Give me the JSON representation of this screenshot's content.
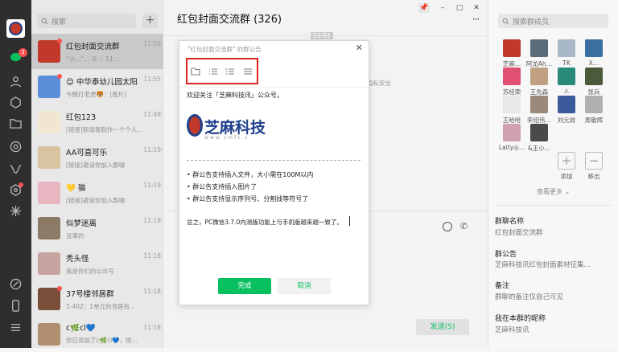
{
  "sidebar": {
    "badge_chat": "2"
  },
  "chatlist": {
    "search_placeholder": "搜索",
    "add_label": "+",
    "items": [
      {
        "name": "红包封面交流群",
        "time": "11:56",
        "msg": "\"小…\"…  ® ：11:…",
        "color": "#c0392b"
      },
      {
        "name": "😊 中华泰幼儿园太阳…",
        "time": "11:55",
        "msg": "今晚打老虎🐯：[图片]",
        "color": "#5a8fd8"
      },
      {
        "name": "红包123",
        "time": "11:48",
        "msg": "[链接]新增我制作一个个人…",
        "color": "#f0e6d2"
      },
      {
        "name": "AA可喜可乐",
        "time": "11:19",
        "msg": "[链接]邀请你加入群聊",
        "color": "#d8c4a0"
      },
      {
        "name": "💛 猫",
        "time": "11:19",
        "msg": "[链接]邀请你加入群聊",
        "color": "#e8b5c0"
      },
      {
        "name": "似梦迷离",
        "time": "11:18",
        "msg": "没事的",
        "color": "#8a7a66"
      },
      {
        "name": "秃头怪",
        "time": "11:18",
        "msg": "我是你们的公众号",
        "color": "#c7a4a0"
      },
      {
        "name": "37号楼邻居群",
        "time": "11:18",
        "msg": "1-402：1单元的邻居有…",
        "color": "#7a4f3a"
      },
      {
        "name": "c🌿cl💙",
        "time": "11:18",
        "msg": "你已添加了c🌿cl💙，现…",
        "color": "#b09070"
      }
    ]
  },
  "main": {
    "title": "红包封面交流群 (326)",
    "time_badge": "11:51",
    "privacy_hint": "隐私安全",
    "send_label": "发送(S)"
  },
  "dialog": {
    "title": "\"红包封面交流群\" 的群公告",
    "close": "✕",
    "line1": "欢迎关注「芝麻科技讯」公众号。",
    "logo_cn": "芝麻科技",
    "logo_url": "www.zmfc.c",
    "bullet1": "• 群公告支持插入文件，大小需在100M以内",
    "bullet2": "• 群公告支持插入图片了",
    "bullet3": "• 群公告支持显示序列号、分割线等符号了",
    "summary": "总之，PC微信3.7.0内测版功能上与手机版越来越一致了。",
    "ok_label": "完成",
    "cancel_label": "取消"
  },
  "right": {
    "search_placeholder": "搜索群成员",
    "members": [
      {
        "name": "芝麻…",
        "color": "#c0392b"
      },
      {
        "name": "阿龙Ah…",
        "color": "#5b6b7a"
      },
      {
        "name": "TK",
        "color": "#a8b8c8"
      },
      {
        "name": "X…",
        "color": "#3a6fa0"
      },
      {
        "name": "苏桂荣",
        "color": "#e05070"
      },
      {
        "name": "王先森",
        "color": "#c0a080"
      },
      {
        "name": "⚠",
        "color": "#2a8a7a"
      },
      {
        "name": "张兵",
        "color": "#4a5a3a"
      },
      {
        "name": "王哈哈",
        "color": "#e8e8e8"
      },
      {
        "name": "李绍伟…",
        "color": "#9a8a7a"
      },
      {
        "name": "刘元效",
        "color": "#3a5a9a"
      },
      {
        "name": "周敬辉",
        "color": "#b0b0b0"
      },
      {
        "name": "Laity◎…",
        "color": "#d0a0b0"
      },
      {
        "name": "&王小…",
        "color": "#4a4a4a"
      }
    ],
    "add_label": "添加",
    "remove_label": "移出",
    "more_label": "查看更多 ⌄",
    "group_name_label": "群聊名称",
    "group_name_value": "红包封面交流群",
    "notice_label": "群公告",
    "notice_value": "芝麻科技讯红包封面素材征集…",
    "remark_label": "备注",
    "remark_value": "群聊的备注仅自己可见",
    "nickname_label": "我在本群的昵称",
    "nickname_value": "芝麻科技讯"
  }
}
